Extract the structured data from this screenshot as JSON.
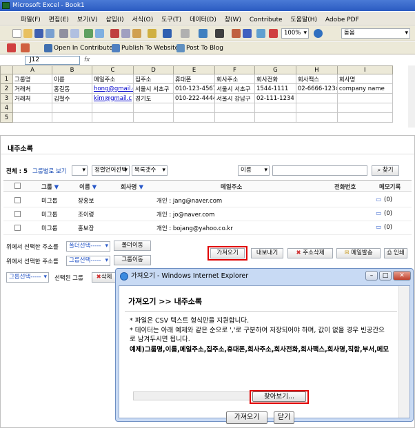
{
  "excel": {
    "title": "Microsoft Excel - Book1",
    "menu": [
      "파일(F)",
      "편집(E)",
      "보기(V)",
      "삽입(I)",
      "서식(O)",
      "도구(T)",
      "데이터(D)",
      "창(W)",
      "Contribute",
      "도움말(H)",
      "Adobe PDF"
    ],
    "zoom": "100%",
    "font": "돋움",
    "toolbar2": [
      "Open In Contribute",
      "Publish To Website",
      "Post To Blog"
    ],
    "namebox": "J12",
    "fx": "fx",
    "columns": [
      "",
      "A",
      "B",
      "C",
      "D",
      "E",
      "F",
      "G",
      "H",
      "I"
    ],
    "rows": [
      [
        "1",
        "그룹명",
        "이름",
        "메일주소",
        "집주소",
        "휴대폰",
        "회사주소",
        "회사전화",
        "회사팩스",
        "회사명"
      ],
      [
        "2",
        "거래처",
        "홍길동",
        "hong@gmail.c",
        "서울시 서초구",
        "010-123-4567",
        "서울시 서초구",
        "1544-1111",
        "02-6666-1234",
        "company name"
      ],
      [
        "3",
        "거래처",
        "김철수",
        "kim@gmail.c",
        "경기도",
        "010-222-4444",
        "서울시 강남구",
        "02-111-1234",
        "",
        ""
      ],
      [
        "4",
        "",
        "",
        "",
        "",
        "",
        "",
        "",
        "",
        ""
      ],
      [
        "5",
        "",
        "",
        "",
        "",
        "",
        "",
        "",
        "",
        ""
      ]
    ]
  },
  "book": {
    "title": "내주소록",
    "total_label": "전체 : 5",
    "view_group": "그룹별로 보기",
    "sort_select": "정렬언어선택",
    "count_select": "목록갯수",
    "search_field": "이름",
    "search_btn": "찾기",
    "headers": [
      "그룹",
      "이름",
      "회사명",
      "메일주소",
      "전화번호",
      "메모기록"
    ],
    "rows": [
      {
        "group": "미그룹",
        "name": "장홍보",
        "email": "개인 : jang@naver.com",
        "memo": "(0)"
      },
      {
        "group": "미그룹",
        "name": "조이령",
        "email": "개인 : jo@naver.com",
        "memo": "(0)"
      },
      {
        "group": "미그룹",
        "name": "홍보장",
        "email": "개인 : bojang@yahoo.co.kr",
        "memo": "(0)"
      }
    ],
    "move_label1": "위에서 선택한 주소를",
    "folder_select": "폴더선택-----",
    "folder_move": "폴더이동",
    "move_label2": "위에서 선택한 주소를",
    "group_select": "그룹선택-----",
    "group_move": "그룹이동",
    "import_btn": "가져오기",
    "export_btn": "내보내기",
    "delete_btn": "주소삭제",
    "mail_btn": "메일발송",
    "print_btn": "인쇄",
    "group_select2": "그룹선택-----",
    "selected_group": "선택된 그룹",
    "delete2": "삭제"
  },
  "dialog": {
    "title": "가져오기 - Windows Internet Explorer",
    "heading": "가져오기 >> 내주소록",
    "line1": "* 파일은 CSV 텍스트 형식만을 지원합니다.",
    "line2": "* 데이터는 아래 예제와 같은 순으로 ','로 구분하여 저장되어야 하며, 값이 없을 경우 빈공간으로 남겨두시면 됩니다.",
    "example": "예제)그룹명,이름,메일주소,집주소,휴대폰,회사주소,회사전화,회사팩스,회사명,직함,부서,메모",
    "browse": "찾아보기...",
    "import": "가져오기",
    "close": "닫기"
  }
}
